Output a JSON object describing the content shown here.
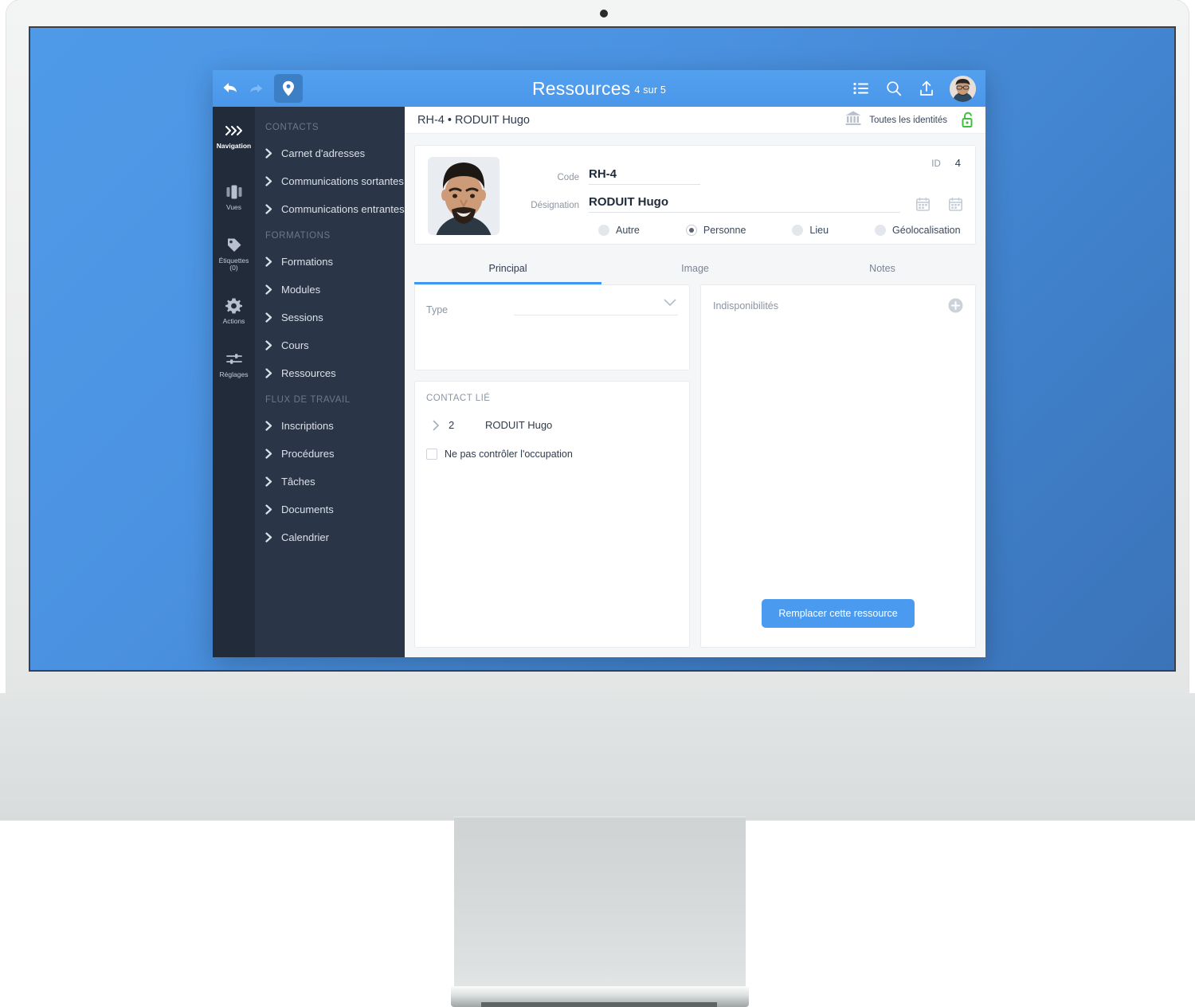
{
  "device": {
    "camera_icon": "camera-dot"
  },
  "topbar": {
    "back_icon": "undo-arrow-icon",
    "forward_icon": "redo-arrow-icon",
    "pin_icon": "map-pin-icon",
    "title": "Ressources",
    "count": "4 sur 5",
    "list_icon": "list-view-icon",
    "search_icon": "search-icon",
    "upload_icon": "upload-icon",
    "avatar_icon": "user-avatar"
  },
  "rail": {
    "items": [
      {
        "label": "Navigation",
        "icon": "chevrons-right-icon",
        "active": true
      },
      {
        "label": "Vues",
        "icon": "columns-icon",
        "active": false
      },
      {
        "label": "Étiquettes\n(0)",
        "label_line1": "Étiquettes",
        "label_line2": "(0)",
        "icon": "tag-icon",
        "active": false
      },
      {
        "label": "Actions",
        "icon": "gear-icon",
        "active": false
      },
      {
        "label": "Réglages",
        "icon": "sliders-icon",
        "active": false
      }
    ]
  },
  "menu": {
    "groups": [
      {
        "title": "CONTACTS",
        "items": [
          {
            "label": "Carnet d'adresses"
          },
          {
            "label": "Communications sortantes"
          },
          {
            "label": "Communications entrantes"
          }
        ]
      },
      {
        "title": "FORMATIONS",
        "items": [
          {
            "label": "Formations"
          },
          {
            "label": "Modules"
          },
          {
            "label": "Sessions"
          },
          {
            "label": "Cours"
          },
          {
            "label": "Ressources"
          }
        ]
      },
      {
        "title": "FLUX DE TRAVAIL",
        "items": [
          {
            "label": "Inscriptions"
          },
          {
            "label": "Procédures"
          },
          {
            "label": "Tâches"
          },
          {
            "label": "Documents"
          },
          {
            "label": "Calendrier"
          }
        ]
      }
    ]
  },
  "content_header": {
    "record_title": "RH-4 • RODUIT Hugo",
    "bank_icon": "bank-institution-icon",
    "identity_label": "Toutes les identités",
    "lock_icon": "unlocked-padlock-icon"
  },
  "record": {
    "portrait_icon": "person-photo",
    "id_label": "ID",
    "id_value": "4",
    "code_label": "Code",
    "code_value": "RH-4",
    "designation_label": "Désignation",
    "designation_value": "RODUIT Hugo",
    "calendar_icon_1": "calendar-icon",
    "calendar_icon_2": "calendar-icon",
    "radios": [
      {
        "label": "Autre",
        "checked": false
      },
      {
        "label": "Personne",
        "checked": true
      },
      {
        "label": "Lieu",
        "checked": false
      },
      {
        "label": "Géolocalisation",
        "checked": false
      }
    ]
  },
  "tabs": [
    {
      "label": "Principal",
      "active": true
    },
    {
      "label": "Image",
      "active": false
    },
    {
      "label": "Notes",
      "active": false
    }
  ],
  "type_card": {
    "label": "Type",
    "value": "",
    "placeholder": "",
    "chevron_icon": "chevron-down-icon"
  },
  "contact_card": {
    "title": "CONTACT LIÉ",
    "row_chevron_icon": "chevron-right-icon",
    "row_number": "2",
    "row_name": "RODUIT Hugo",
    "checkbox_label": "Ne pas contrôler l'occupation",
    "checkbox_checked": false
  },
  "indispo_card": {
    "title": "Indisponibilités",
    "add_icon": "plus-circle-icon",
    "button_label": "Remplacer cette ressource"
  },
  "colors": {
    "accent_blue": "#4a9bef",
    "topbar_blue": "#4a97ea",
    "rail_dark": "#222b3a",
    "menu_dark": "#2a3547",
    "lock_green": "#3fbf3f",
    "content_bg": "#f4f6f8"
  }
}
